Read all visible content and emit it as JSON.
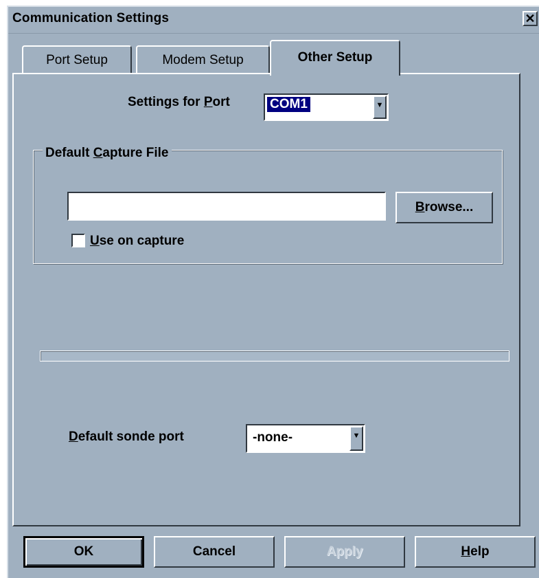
{
  "window": {
    "title": "Communication Settings",
    "close_glyph": "✕"
  },
  "tabs": [
    {
      "label": "Port Setup",
      "active": false
    },
    {
      "label": "Modem Setup",
      "active": false
    },
    {
      "label": "Other Setup",
      "active": true
    }
  ],
  "port": {
    "label_pre": "Settings for ",
    "label_key": "P",
    "label_post": "ort",
    "value": "COM1"
  },
  "capture": {
    "group_pre": "Default ",
    "group_key": "C",
    "group_post": "apture File",
    "file_value": "",
    "browse_key": "B",
    "browse_rest": "rowse...",
    "use_key": "U",
    "use_rest": "se on capture",
    "use_checked": false
  },
  "sonde": {
    "label_key": "D",
    "label_rest": "efault sonde port",
    "value": "-none-"
  },
  "buttons": {
    "ok": "OK",
    "cancel": "Cancel",
    "apply": "Apply",
    "help_key": "H",
    "help_rest": "elp"
  },
  "colors": {
    "face": "#a0b0c0",
    "highlight": "#000080"
  }
}
